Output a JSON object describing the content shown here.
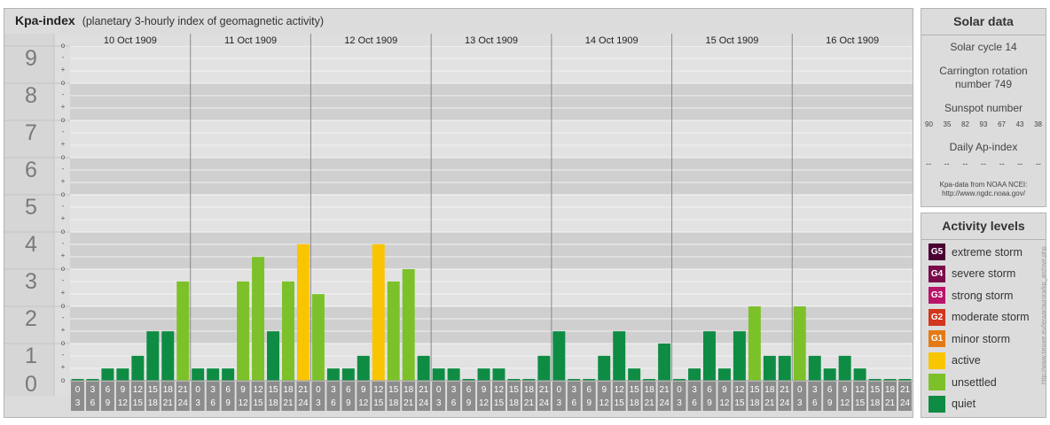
{
  "title": "Kpa-index",
  "subtitle": "(planetary 3-hourly index of geomagnetic activity)",
  "chart_data": {
    "type": "bar",
    "ylim": [
      0,
      9
    ],
    "y_ticks": [
      "0",
      "1",
      "2",
      "3",
      "4",
      "5",
      "6",
      "7",
      "8",
      "9"
    ],
    "sub_ticks": [
      "o",
      "-",
      "+"
    ],
    "days": [
      "10 Oct 1909",
      "11 Oct 1909",
      "12 Oct 1909",
      "13 Oct 1909",
      "14 Oct 1909",
      "15 Oct 1909",
      "16 Oct 1909"
    ],
    "interval_labels": [
      [
        "0",
        "3"
      ],
      [
        "3",
        "6"
      ],
      [
        "6",
        "9"
      ],
      [
        "9",
        "12"
      ],
      [
        "12",
        "15"
      ],
      [
        "15",
        "18"
      ],
      [
        "18",
        "21"
      ],
      [
        "21",
        "24"
      ]
    ],
    "values": [
      [
        0,
        0,
        0.33,
        0.33,
        0.67,
        1.33,
        1.33,
        2.67
      ],
      [
        0.33,
        0.33,
        0.33,
        2.67,
        3.33,
        1.33,
        2.67,
        3.67
      ],
      [
        2.33,
        0.33,
        0.33,
        0.67,
        3.67,
        2.67,
        3.0,
        0.67
      ],
      [
        0.33,
        0.33,
        0,
        0.33,
        0.33,
        0,
        0,
        0.67
      ],
      [
        1.33,
        0,
        0,
        0.67,
        1.33,
        0.33,
        0,
        1.0
      ],
      [
        0,
        0.33,
        1.33,
        0.33,
        1.33,
        2.0,
        0.67,
        0.67
      ],
      [
        2.0,
        0.67,
        0.33,
        0.67,
        0.33,
        0,
        0,
        0
      ]
    ],
    "level_colors": {
      "quiet": "#0f8c44",
      "unsettled": "#7dc12a",
      "active": "#f9c500"
    },
    "grid": true
  },
  "solar": {
    "header": "Solar data",
    "cycle": "Solar cycle 14",
    "carrington_line1": "Carrington rotation",
    "carrington_line2": "number 749",
    "sunspot_label": "Sunspot number",
    "sunspots": [
      "90",
      "35",
      "82",
      "93",
      "67",
      "43",
      "38"
    ],
    "ap_label": "Daily Ap-index",
    "ap": [
      "--",
      "--",
      "--",
      "--",
      "--",
      "--",
      "--"
    ],
    "source_line1": "Kpa-data from NOAA NCEI:",
    "source_line2": "http://www.ngdc.noaa.gov/"
  },
  "activity": {
    "header": "Activity levels",
    "levels": [
      {
        "badge": "G5",
        "label": "extreme storm",
        "color": "#4a0033"
      },
      {
        "badge": "G4",
        "label": "severe storm",
        "color": "#7a0a4a"
      },
      {
        "badge": "G3",
        "label": "strong storm",
        "color": "#b8146a"
      },
      {
        "badge": "G2",
        "label": "moderate storm",
        "color": "#d2361f"
      },
      {
        "badge": "G1",
        "label": "minor storm",
        "color": "#e57a14"
      },
      {
        "badge": "",
        "label": "active",
        "color": "#f9c500"
      },
      {
        "badge": "",
        "label": "unsettled",
        "color": "#7dc12a"
      },
      {
        "badge": "",
        "label": "quiet",
        "color": "#0f8c44"
      }
    ]
  },
  "credit": "http://www.tieuwe.eu/leraar/aurora/kp_archive.php"
}
